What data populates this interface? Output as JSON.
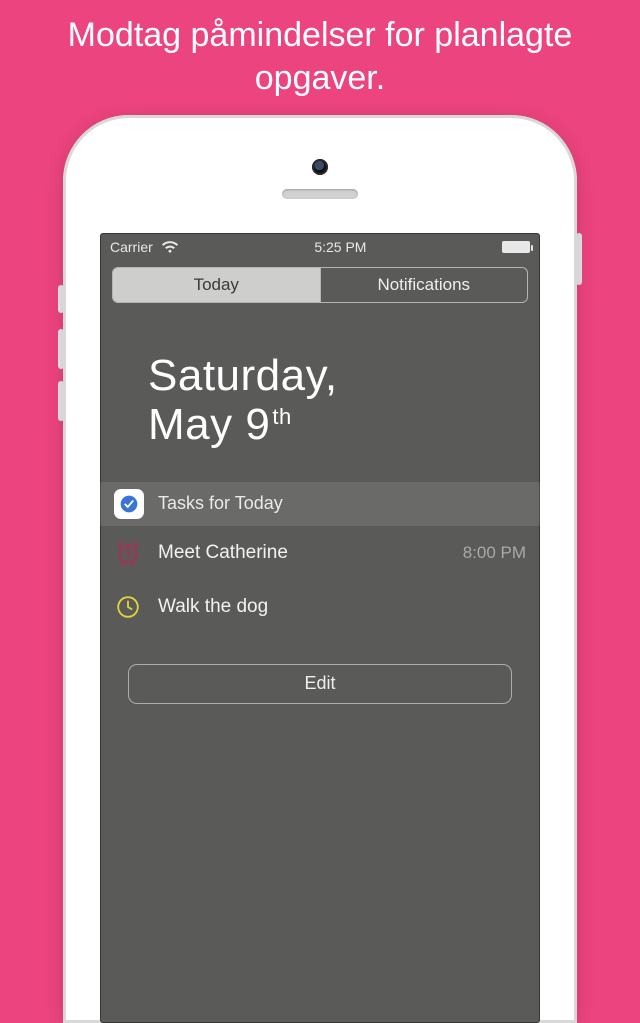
{
  "promo": {
    "headline": "Modtag påmindelser for planlagte opgaver."
  },
  "statusbar": {
    "carrier": "Carrier",
    "time": "5:25 PM"
  },
  "segmented": {
    "today": "Today",
    "notifications": "Notifications"
  },
  "date": {
    "weekday": "Saturday,",
    "month_day": "May 9",
    "ordinal": "th"
  },
  "widget": {
    "title": "Tasks for Today",
    "app_icon_name": "tasks-app-icon",
    "tasks": [
      {
        "icon": "alarm-icon",
        "icon_color": "#b02a5a",
        "title": "Meet Catherine",
        "time": "8:00 PM"
      },
      {
        "icon": "clock-icon",
        "icon_color": "#e0d23a",
        "title": "Walk the dog",
        "time": ""
      }
    ],
    "edit_label": "Edit"
  },
  "colors": {
    "background": "#ec447e",
    "screen": "#5a5a59"
  }
}
